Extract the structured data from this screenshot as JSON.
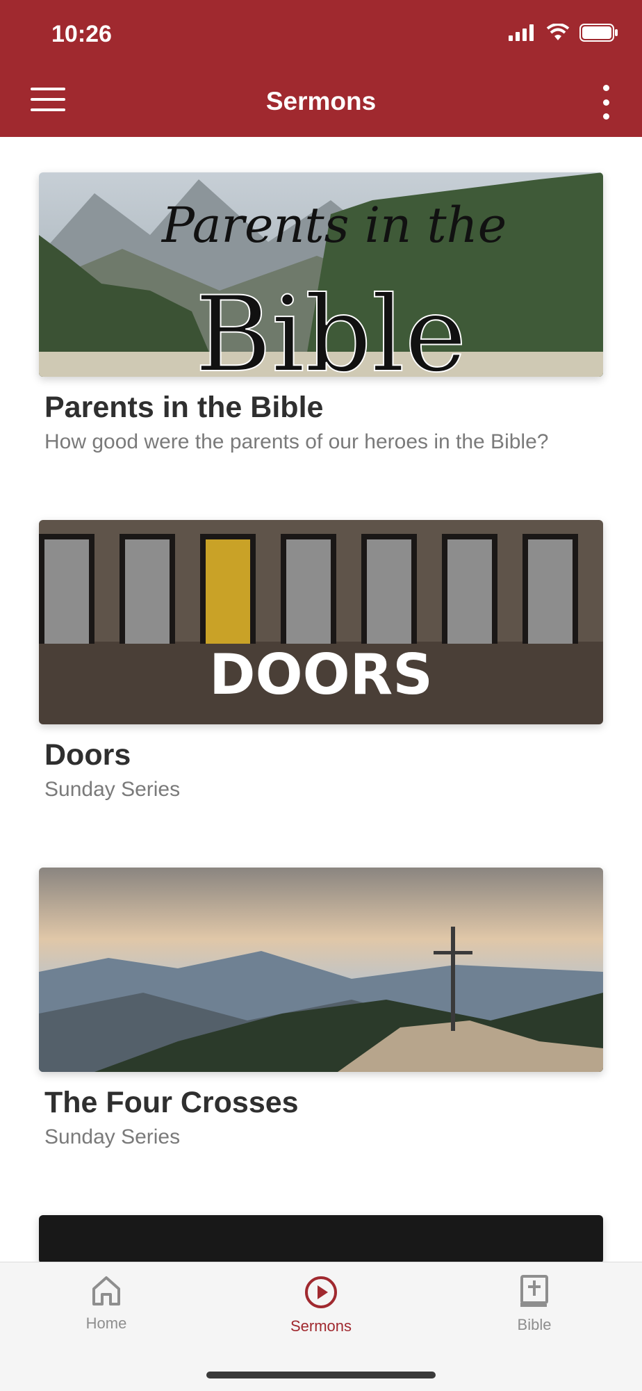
{
  "status": {
    "time": "10:26"
  },
  "appbar": {
    "title": "Sermons"
  },
  "sermons": [
    {
      "title": "Parents in the Bible",
      "subtitle": "How good were the parents of our heroes in the Bible?",
      "art_script": "Parents in the",
      "art_word": "Bible"
    },
    {
      "title": "Doors",
      "subtitle": "Sunday Series",
      "art_word": "DOORS"
    },
    {
      "title": "The Four Crosses",
      "subtitle": "Sunday Series"
    }
  ],
  "tabs": [
    {
      "label": "Home",
      "icon": "home-icon",
      "active": false
    },
    {
      "label": "Sermons",
      "icon": "play-circle-icon",
      "active": true
    },
    {
      "label": "Bible",
      "icon": "bible-icon",
      "active": false
    }
  ],
  "colors": {
    "brand": "#a0292f",
    "inactive": "#8e8e8e"
  }
}
